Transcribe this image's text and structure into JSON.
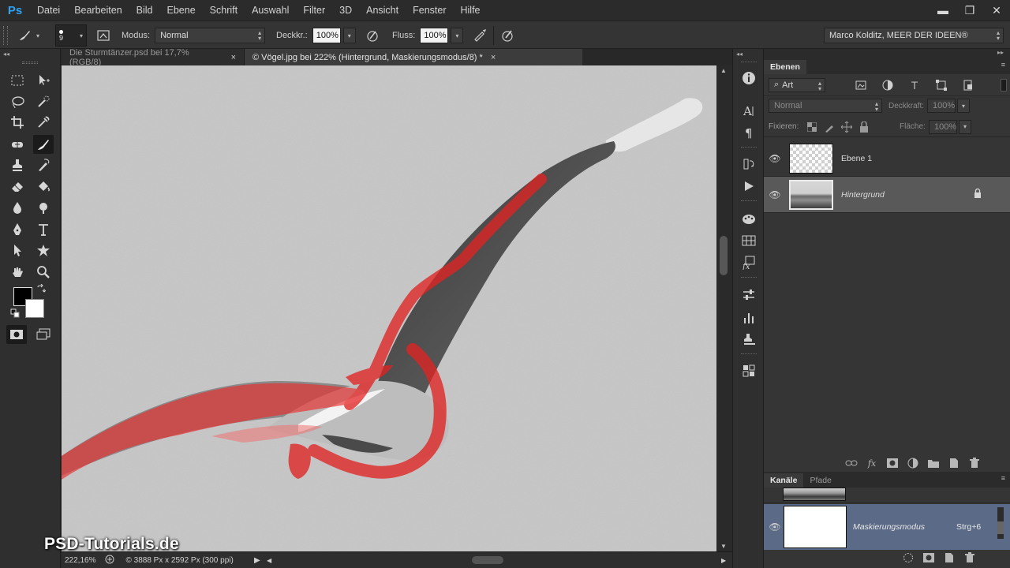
{
  "app": {
    "logo": "Ps"
  },
  "menu": [
    "Datei",
    "Bearbeiten",
    "Bild",
    "Ebene",
    "Schrift",
    "Auswahl",
    "Filter",
    "3D",
    "Ansicht",
    "Fenster",
    "Hilfe"
  ],
  "window_controls": {
    "minimize": "▬",
    "restore": "❐",
    "close": "✕"
  },
  "options": {
    "brush_size": "9",
    "mode_label": "Modus:",
    "mode_value": "Normal",
    "opacity_label": "Deckkr.:",
    "opacity_value": "100%",
    "flow_label": "Fluss:",
    "flow_value": "100%",
    "workspace": "Marco Kolditz, MEER DER IDEEN®"
  },
  "tabs": [
    {
      "label": "Die Sturmtänzer.psd bei 17,7% (RGB/8)",
      "active": false
    },
    {
      "label": "© Vögel.jpg bei 222% (Hintergrund, Maskierungsmodus/8) *",
      "active": true
    }
  ],
  "tab_close": "×",
  "status": {
    "zoom": "222,16%",
    "doc_info": "© 3888 Px x 2592 Px (300 ppi)"
  },
  "watermark": "PSD-Tutorials.de",
  "colors": {
    "foreground": "#000000",
    "background": "#ffffff",
    "quickmask_overlay": "#e02020",
    "panel_highlight": "#5b6a86"
  },
  "layers_panel": {
    "tab": "Ebenen",
    "filter_kind": "Art",
    "blend_mode": "Normal",
    "opacity_label": "Deckkraft:",
    "opacity_value": "100%",
    "lock_label": "Fixieren:",
    "fill_label": "Fläche:",
    "fill_value": "100%",
    "layers": [
      {
        "name": "Ebene 1",
        "selected": false,
        "locked": false
      },
      {
        "name": "Hintergrund",
        "selected": true,
        "locked": true
      }
    ]
  },
  "channels_panel": {
    "tabs": [
      "Kanäle",
      "Pfade"
    ],
    "channels": [
      {
        "name": "Maskierungsmodus",
        "shortcut": "Strg+6",
        "selected": true
      }
    ]
  },
  "icons": {
    "left_tools": [
      "marquee-icon",
      "move-icon",
      "lasso-icon",
      "quick-selection-icon",
      "crop-icon",
      "eyedropper-icon",
      "spot-heal-icon",
      "brush-icon",
      "stamp-icon",
      "history-brush-icon",
      "eraser-icon",
      "paint-bucket-icon",
      "blur-icon",
      "dodge-icon",
      "pen-icon",
      "type-icon",
      "path-select-icon",
      "shape-icon",
      "hand-icon",
      "zoom-icon"
    ],
    "dock": [
      "info-icon",
      "character-icon",
      "paragraph-icon",
      "history-icon",
      "actions-icon",
      "swatches-icon",
      "styles-icon",
      "fx-icon",
      "adjustments-icon",
      "brush-presets-icon",
      "clone-source-icon",
      "3d-icon"
    ]
  }
}
